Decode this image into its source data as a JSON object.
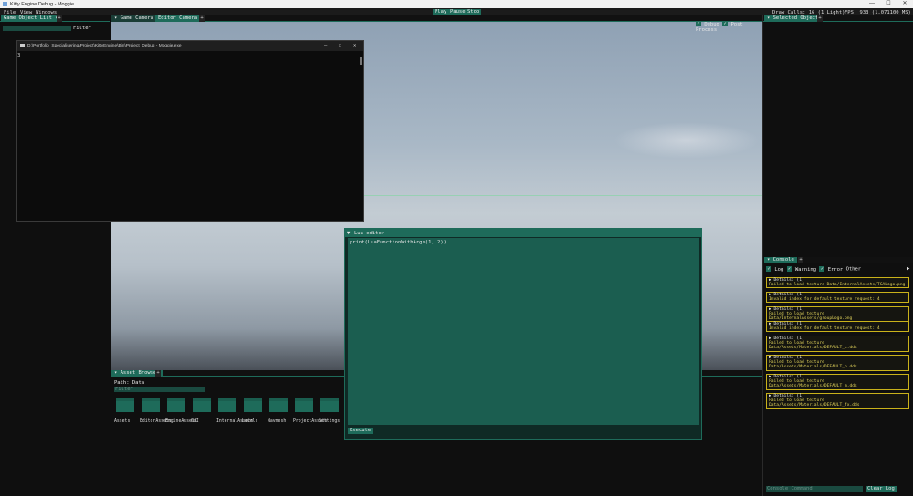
{
  "window": {
    "title": "Kitty Engine Debug - Moggie",
    "minimize": "—",
    "maximize": "☐",
    "close": "✕"
  },
  "menu": {
    "file": "File",
    "view": "View",
    "windows": "Windows"
  },
  "toolbar": {
    "play": "Play",
    "pause": "Pause",
    "stop": "Stop",
    "draw_calls": "Draw Calls: 16 (1 Light)",
    "fps": "FPS: 933 (1.071100 MS)"
  },
  "game_object_list": {
    "tab": "Game Object List",
    "filter_label": "Filter"
  },
  "viewport": {
    "tabs": [
      "Game Camera",
      "Editor Camera"
    ],
    "debug_label": "Debug",
    "post_process_label": "Post Process"
  },
  "console_window": {
    "title": "D:\\Portfolio_Specialisering\\Project\\KittyEngine\\Bin\\Project_Debug - Moggie.exe",
    "text": "3",
    "minimize": "—",
    "maximize": "☐",
    "close": "✕"
  },
  "lua_editor": {
    "title": "Lua editor",
    "code": "print(LuaFunctionWithArgs(1, 2))",
    "execute": "Execute"
  },
  "asset_browser": {
    "tab": "Asset Browser",
    "path": "Path: Data",
    "filter_placeholder": "Filter",
    "folders": [
      "Assets",
      "EditorAssets",
      "EngineAssets",
      "GUI",
      "InternalAssets",
      "Levels",
      "Navmesh",
      "ProjectAssets",
      "Settings"
    ]
  },
  "selected_object": {
    "tab": "Selected Object"
  },
  "console": {
    "tab": "Console",
    "log": "Log",
    "warning": "Warning",
    "error": "Error",
    "other": "Other",
    "command_placeholder": "Console Command",
    "clear": "Clear Log",
    "entries": [
      {
        "details": "▶ Details: (1)",
        "msg": "Failed to load texture Data/InternalAssets/TGALogo.png"
      },
      {
        "details": "▶ Details: (1)",
        "msg": "Invalid index for default texture request: 4"
      },
      {
        "details": "▶ Details: (1)",
        "msg": "Failed to load texture Data/InternalAssets/groupLogo.png"
      },
      {
        "details": "▶ Details: (1)",
        "msg": "Invalid index for default texture request: 4"
      },
      {
        "details": "▶ Details: (1)",
        "msg": "Failed to load texture Data/Assets/Materials/DEFAULT_c.dds"
      },
      {
        "details": "▶ Details: (1)",
        "msg": "Failed to load texture Data/Assets/Materials/DEFAULT_n.dds"
      },
      {
        "details": "▶ Details: (1)",
        "msg": "Failed to load texture Data/Assets/Materials/DEFAULT_m.dds"
      },
      {
        "details": "▶ Details: (1)",
        "msg": "Failed to load texture Data/Assets/Materials/DEFAULT_fx.dds"
      }
    ]
  },
  "colors": {
    "accent": "#1e6b5a",
    "warning_border": "#c9b21a"
  }
}
